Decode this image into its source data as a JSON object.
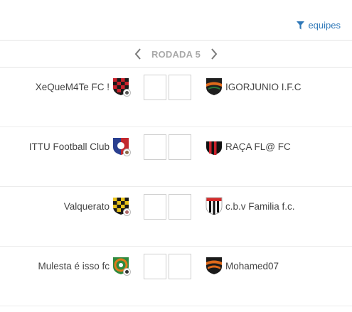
{
  "filter": {
    "label": "equipes",
    "icon": "filter-icon",
    "color": "#2f78b8"
  },
  "round": {
    "label": "RODADA 5",
    "prev_icon": "chevron-left-icon",
    "next_icon": "chevron-right-icon"
  },
  "matches": [
    {
      "home": {
        "name": "XeQueM4Te FC !",
        "crest_colors": [
          "#1a1a1a",
          "#c8202a"
        ]
      },
      "away": {
        "name": "IGORJUNIO I.F.C",
        "crest_colors": [
          "#1f1f1f",
          "#e06a1b",
          "#2a7a3a"
        ]
      },
      "home_score": "",
      "away_score": ""
    },
    {
      "home": {
        "name": "ITTU Football Club",
        "crest_colors": [
          "#c2282f",
          "#2a3f8f"
        ]
      },
      "away": {
        "name": "RAÇA FL@ FC",
        "crest_colors": [
          "#c8202a",
          "#111111"
        ]
      },
      "home_score": "",
      "away_score": ""
    },
    {
      "home": {
        "name": "Valquerato",
        "crest_colors": [
          "#e8c21a",
          "#1a1a1a"
        ]
      },
      "away": {
        "name": "c.b.v Familia f.c.",
        "crest_colors": [
          "#111111",
          "#ffffff",
          "#d42a2a"
        ]
      },
      "home_score": "",
      "away_score": ""
    },
    {
      "home": {
        "name": "Mulesta é isso fc",
        "crest_colors": [
          "#2f8a3e",
          "#e07a1b"
        ]
      },
      "away": {
        "name": "Mohamed07",
        "crest_colors": [
          "#1a1a1a",
          "#e06a1b"
        ]
      },
      "home_score": "",
      "away_score": ""
    }
  ]
}
